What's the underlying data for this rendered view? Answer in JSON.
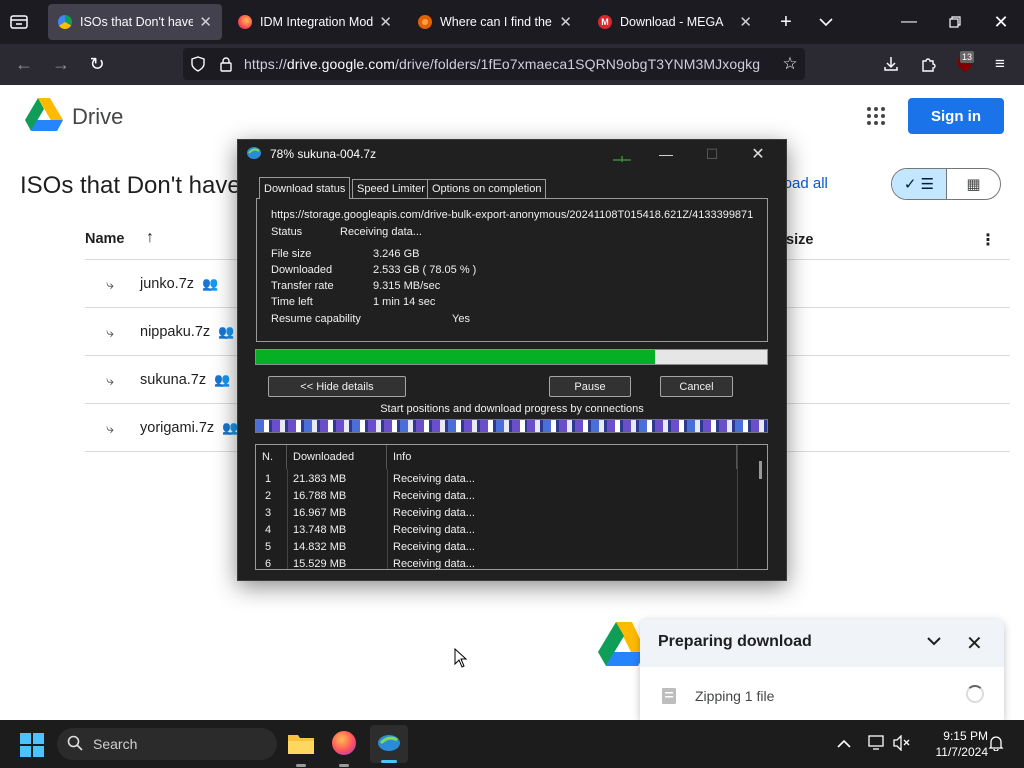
{
  "browser": {
    "tabs": [
      {
        "title": "ISOs that Don't haven't",
        "favicon": "google-drive-icon",
        "color": "#fbbc04"
      },
      {
        "title": "IDM Integration Modul",
        "favicon": "firefox-addons-icon",
        "color": "#ff7139"
      },
      {
        "title": "Where can I find the te",
        "favicon": "mozilla-community-icon",
        "color": "#e66000"
      },
      {
        "title": "Download - MEGA",
        "favicon": "mega-icon",
        "color": "#d9272e"
      }
    ],
    "url_prefix": "https://",
    "url_domain": "drive.google.com",
    "url_path": "/drive/folders/1fEo7xmaeca1SQRN9obgT3YNM3MJxogkg",
    "extension_badge": "13"
  },
  "drive": {
    "logo_text": "Drive",
    "signin_label": "Sign in",
    "folder_title": "ISOs that Don't have",
    "download_all_label": "nload all",
    "columns": {
      "name": "Name",
      "size": "size"
    },
    "files": [
      {
        "name": "junko.7z"
      },
      {
        "name": "nippaku.7z"
      },
      {
        "name": "sukuna.7z"
      },
      {
        "name": "yorigami.7z"
      }
    ]
  },
  "idm": {
    "title": "78% sukuna-004.7z",
    "tabs": [
      "Download status",
      "Speed Limiter",
      "Options on completion"
    ],
    "url": "https://storage.googleapis.com/drive-bulk-export-anonymous/20241108T015418.621Z/4133399871",
    "status_label": "Status",
    "status_value": "Receiving data...",
    "file_size_label": "File size",
    "file_size_value": "3.246  GB",
    "downloaded_label": "Downloaded",
    "downloaded_value": "2.533  GB  ( 78.05 % )",
    "transfer_rate_label": "Transfer rate",
    "transfer_rate_value": "9.315  MB/sec",
    "time_left_label": "Time left",
    "time_left_value": "1 min 14 sec",
    "resume_label": "Resume capability",
    "resume_value": "Yes",
    "progress_percent": 78.05,
    "hide_details_label": "<< Hide details",
    "pause_label": "Pause",
    "cancel_label": "Cancel",
    "connections_label": "Start positions and download progress by connections",
    "table_headers": [
      "N.",
      "Downloaded",
      "Info"
    ],
    "connections": [
      {
        "n": "1",
        "downloaded": "21.383  MB",
        "info": "Receiving data..."
      },
      {
        "n": "2",
        "downloaded": "16.788  MB",
        "info": "Receiving data..."
      },
      {
        "n": "3",
        "downloaded": "16.967  MB",
        "info": "Receiving data..."
      },
      {
        "n": "4",
        "downloaded": "13.748  MB",
        "info": "Receiving data..."
      },
      {
        "n": "5",
        "downloaded": "14.832  MB",
        "info": "Receiving data..."
      },
      {
        "n": "6",
        "downloaded": "15.529  MB",
        "info": "Receiving data..."
      }
    ]
  },
  "notification": {
    "title": "Preparing download",
    "item": "Zipping 1 file"
  },
  "taskbar": {
    "search_placeholder": "Search",
    "time": "9:15 PM",
    "date": "11/7/2024"
  }
}
